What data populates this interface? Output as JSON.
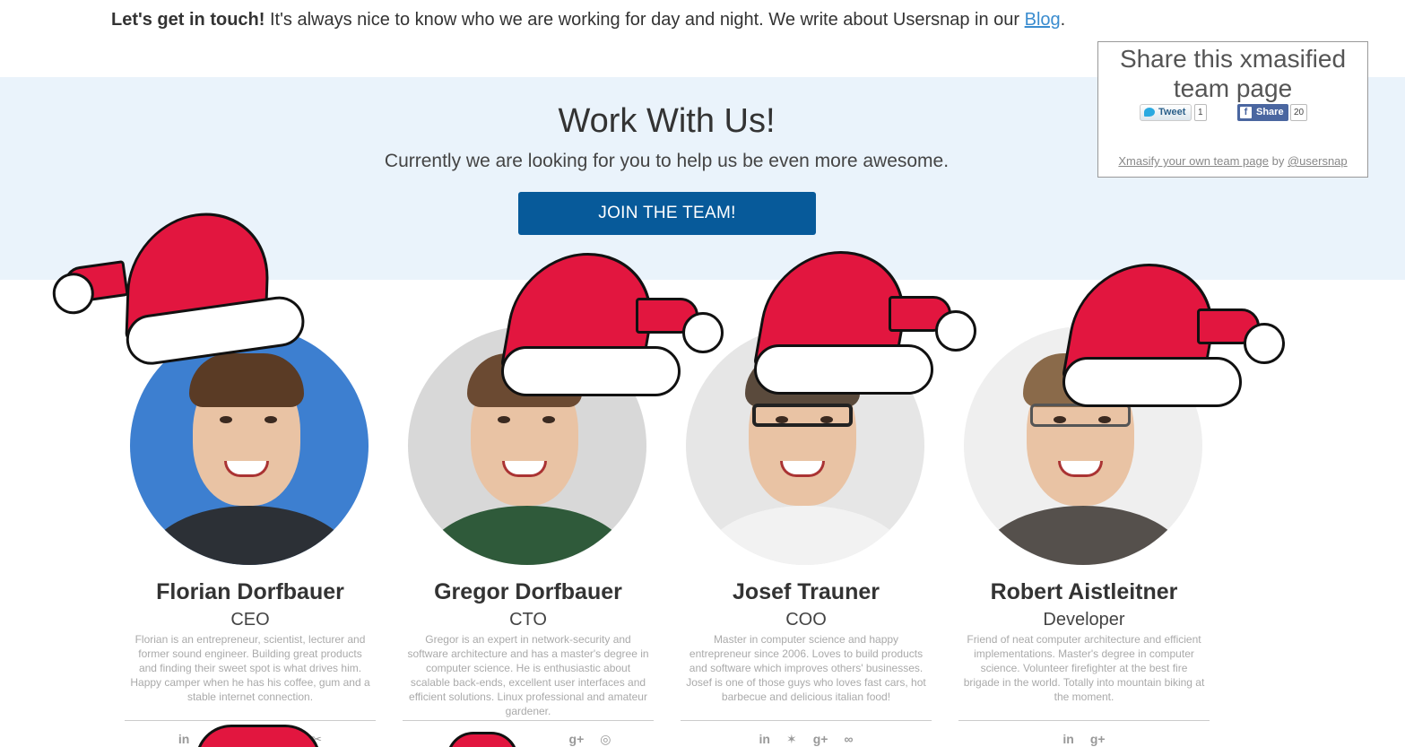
{
  "intro": {
    "bold": "Let's get in touch!",
    "text": " It's always nice to know who we are working for day and night. We write about Usersnap in our ",
    "link": "Blog",
    "end": "."
  },
  "band": {
    "title": "Work With Us!",
    "subtitle": "Currently we are looking for you to help us be even more awesome.",
    "button": "JOIN THE TEAM!"
  },
  "share": {
    "title": "Share this xmasified team page",
    "tweet_label": "Tweet",
    "tweet_count": "1",
    "fb_label": "Share",
    "fb_count": "20",
    "foot_link": "Xmasify your own team page",
    "foot_by": " by ",
    "foot_user": "@usersnap"
  },
  "team": [
    {
      "name": "Florian Dorfbauer",
      "role": "CEO",
      "bio": "Florian is an entrepreneur, scientist, lecturer and former sound engineer. Building great products and finding their sweet spot is what drives him. Happy camper when he has his coffee, gum and a stable internet connection.",
      "social": [
        "in",
        "✂"
      ]
    },
    {
      "name": "Gregor Dorfbauer",
      "role": "CTO",
      "bio": "Gregor is an expert in network-security and software architecture and has a master's degree in computer science. He is enthusiastic about scalable back-ends, excellent user interfaces and efficient solutions. Linux professional and amateur gardener.",
      "social": [
        "g+",
        "◎"
      ]
    },
    {
      "name": "Josef Trauner",
      "role": "COO",
      "bio": "Master in computer science and happy entrepreneur since 2006. Loves to build products and software which improves others' businesses. Josef is one of those guys who loves fast cars, hot barbecue and delicious italian food!",
      "social": [
        "in",
        "✶",
        "g+",
        "∞"
      ]
    },
    {
      "name": "Robert Aistleitner",
      "role": "Developer",
      "bio": "Friend of neat computer architecture and efficient implementations. Master's degree in computer science. Volunteer firefighter at the best fire brigade in the world. Totally into mountain biking at the moment.",
      "social": [
        "in",
        "g+"
      ]
    }
  ],
  "colors": {
    "band_bg": "#eaf3fb",
    "button_bg": "#075a9a",
    "hat_red": "#e2163f"
  }
}
